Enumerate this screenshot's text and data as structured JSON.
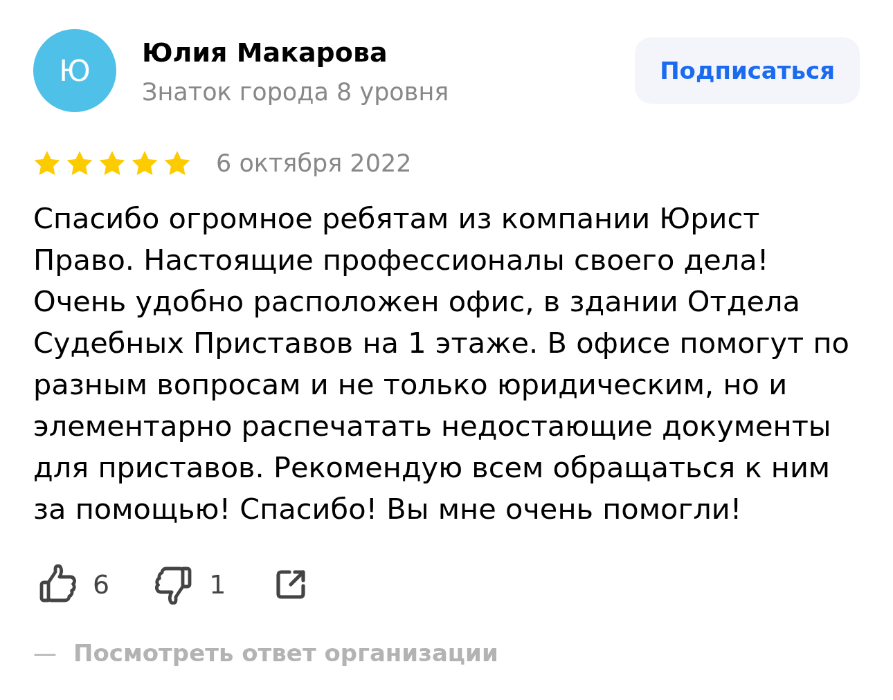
{
  "review": {
    "author": {
      "initial": "Ю",
      "name": "Юлия Макарова",
      "status": "Знаток города 8 уровня"
    },
    "subscribe_button": {
      "label": "Подписаться"
    },
    "rating": {
      "stars": 5
    },
    "date": "6 октября 2022",
    "text": "Спасибо огромное ребятам из компании Юрист Право. Настоящие профессионалы своего дела! Очень удобно расположен офис, в здании Отдела Судебных Приставов на 1 этаже. В офисе помогут по разным вопросам и не только юридическим, но и элементарно распечатать недостающие документы для приставов. Рекомендую всем обращаться к ним за помощью! Спасибо! Вы мне очень помогли!",
    "actions": {
      "likes": "6",
      "dislikes": "1"
    },
    "reply_link": {
      "prefix": "—",
      "label": "Посмотреть ответ организации"
    }
  }
}
